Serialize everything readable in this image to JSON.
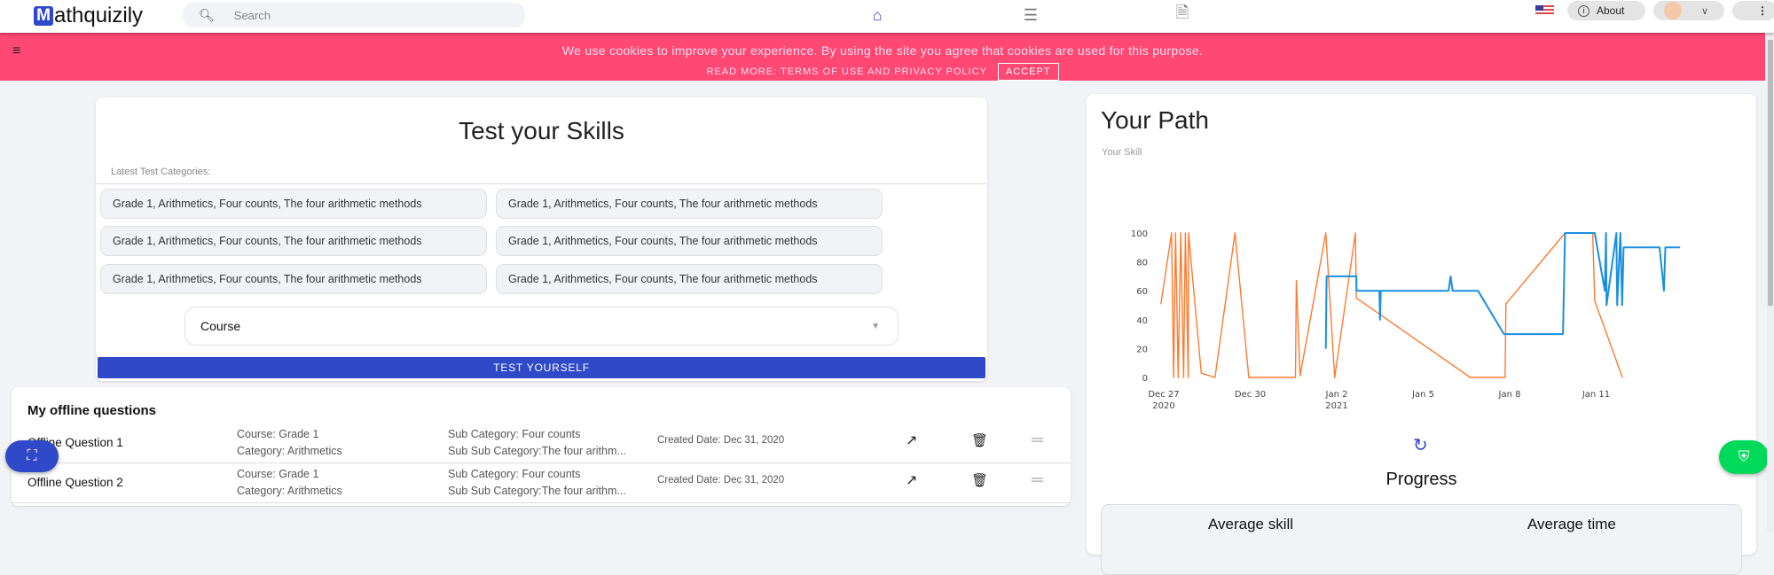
{
  "nav": {
    "logo": "Mathquizily",
    "search_placeholder": "Search",
    "about": "About",
    "icons": [
      "home-icon",
      "list-icon",
      "document-icon"
    ],
    "accent": "#2f49c9"
  },
  "cookie": {
    "message": "We use cookies to improve your experience. By using the site you agree that cookies are used for this purpose.",
    "read_more": "READ MORE: TERMS OF USE AND PRIVACY POLICY",
    "accept": "ACCEPT",
    "color": "#ff4874"
  },
  "test": {
    "title": "Test your Skills",
    "latest_label": "Latest Test Categories:",
    "categories": [
      "Grade 1, Arithmetics, Four counts, The four arithmetic methods",
      "Grade 1, Arithmetics, Four counts, The four arithmetic methods",
      "Grade 1, Arithmetics, Four counts, The four arithmetic methods",
      "Grade 1, Arithmetics, Four counts, The four arithmetic methods",
      "Grade 1, Arithmetics, Four counts, The four arithmetic methods",
      "Grade 1, Arithmetics, Four counts, The four arithmetic methods"
    ],
    "course_select": "Course",
    "button": "TEST YOURSELF"
  },
  "offline": {
    "title": "My offline questions",
    "rows": [
      {
        "name": "Offline Question 1",
        "course": "Course: Grade 1",
        "category": "Category: Arithmetics",
        "sub": "Sub Category: Four counts",
        "subsub": "Sub Sub Category:The four arithm...",
        "created": "Created Date: Dec 31, 2020"
      },
      {
        "name": "Offline Question 2",
        "course": "Course: Grade 1",
        "category": "Category: Arithmetics",
        "sub": "Sub Category: Four counts",
        "subsub": "Sub Sub Category:The four arithm...",
        "created": "Created Date: Dec 31, 2020"
      }
    ]
  },
  "path": {
    "title": "Your Path",
    "subtitle": "Your Skill",
    "progress": "Progress",
    "avg_skill": "Average skill",
    "avg_time": "Average time"
  },
  "chart_data": {
    "type": "line",
    "title": "",
    "xlabel": "",
    "ylabel": "",
    "grid": false,
    "ylim": [
      0,
      100
    ],
    "yticks": [
      "0",
      "20",
      "40",
      "60",
      "80",
      "100"
    ],
    "xticks": [
      {
        "date": "2020-12-27",
        "label": "Dec 27",
        "sub": "2020"
      },
      {
        "date": "2020-12-30",
        "label": "Dec 30",
        "sub": ""
      },
      {
        "date": "2021-01-02",
        "label": "Jan 2",
        "sub": "2021"
      },
      {
        "date": "2021-01-05",
        "label": "Jan 5",
        "sub": ""
      },
      {
        "date": "2021-01-08",
        "label": "Jan 8",
        "sub": ""
      },
      {
        "date": "2021-01-11",
        "label": "Jan 11",
        "sub": ""
      }
    ],
    "series": [
      {
        "color": "#ff7a30",
        "points": [
          [
            "2020-12-26T21:36",
            51
          ],
          [
            "2020-12-27T06:29",
            100
          ],
          [
            "2020-12-27T08:10",
            0
          ],
          [
            "2020-12-27T09:50",
            100
          ],
          [
            "2020-12-27T12:00",
            0
          ],
          [
            "2020-12-27T14:10",
            100
          ],
          [
            "2020-12-27T16:34",
            0
          ],
          [
            "2020-12-27T18:00",
            100
          ],
          [
            "2020-12-27T20:24",
            0
          ],
          [
            "2020-12-27T20:38",
            100
          ],
          [
            "2020-12-28T07:12",
            3
          ],
          [
            "2020-12-28T18:43",
            0
          ],
          [
            "2020-12-29T11:17",
            100
          ],
          [
            "2020-12-29T22:48",
            0
          ],
          [
            "2020-12-31T07:41",
            0
          ],
          [
            "2020-12-31T13:41",
            0
          ],
          [
            "2020-12-31T14:24",
            67
          ],
          [
            "2020-12-31T17:31",
            1
          ],
          [
            "2021-01-01T14:53",
            100
          ],
          [
            "2021-01-01T22:19",
            0
          ],
          [
            "2021-01-02T15:36",
            100
          ],
          [
            "2021-01-02T16:19",
            55
          ],
          [
            "2021-01-06T15:07",
            0
          ],
          [
            "2021-01-07T20:10",
            0
          ],
          [
            "2021-01-07T20:53",
            51
          ],
          [
            "2021-01-09T22:05",
            100
          ],
          [
            "2021-01-10T21:07",
            100
          ],
          [
            "2021-01-10T22:48",
            53
          ],
          [
            "2021-01-11T21:50",
            0
          ]
        ]
      },
      {
        "color": "#1a8fe0",
        "points": [
          [
            "2021-01-01T14:53",
            20
          ],
          [
            "2021-01-01T15:36",
            70
          ],
          [
            "2021-01-02T16:19",
            70
          ],
          [
            "2021-01-02T16:34",
            60
          ],
          [
            "2021-01-03T11:31",
            60
          ],
          [
            "2021-01-03T12:00",
            40
          ],
          [
            "2021-01-03T12:43",
            60
          ],
          [
            "2021-01-05T21:07",
            60
          ],
          [
            "2021-01-05T22:48",
            70
          ],
          [
            "2021-01-06T00:29",
            60
          ],
          [
            "2021-01-06T21:36",
            60
          ],
          [
            "2021-01-07T19:12",
            30
          ],
          [
            "2021-01-09T20:24",
            30
          ],
          [
            "2021-01-09T22:05",
            100
          ],
          [
            "2021-01-10T22:48",
            100
          ],
          [
            "2021-01-11T07:12",
            60
          ],
          [
            "2021-01-11T08:10",
            100
          ],
          [
            "2021-01-11T08:38",
            50
          ],
          [
            "2021-01-11T16:48",
            100
          ],
          [
            "2021-01-11T17:31",
            50
          ],
          [
            "2021-01-11T20:10",
            100
          ],
          [
            "2021-01-11T21:36",
            50
          ],
          [
            "2021-01-11T22:48",
            90
          ],
          [
            "2021-01-13T04:48",
            90
          ],
          [
            "2021-01-13T08:24",
            60
          ],
          [
            "2021-01-13T09:36",
            90
          ],
          [
            "2021-01-13T21:36",
            90
          ]
        ]
      }
    ]
  }
}
